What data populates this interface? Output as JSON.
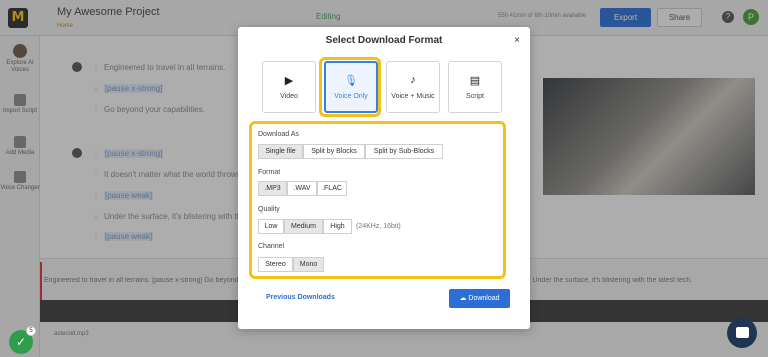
{
  "app": {
    "project_title": "My Awesome Project",
    "crumb": "Home",
    "mode": "Editing",
    "usage": "55h 41min of 6th 10min available",
    "export_label": "Export",
    "share_label": "Share",
    "help_glyph": "?",
    "avatar_initial": "P",
    "logo_glyph": "M"
  },
  "sidebar": {
    "items": [
      {
        "label": "Explore AI Voices",
        "icon": "voice-avatar-icon"
      },
      {
        "label": "Import Script",
        "icon": "import-icon"
      },
      {
        "label": "Add Media",
        "icon": "media-icon"
      },
      {
        "label": "Voice Changer",
        "icon": "voice-changer-icon"
      }
    ]
  },
  "editor": {
    "lines": [
      "Engineered to travel in all terrains.",
      "[pause x-strong]",
      "Go beyond your capabilities.",
      "[pause x-strong]",
      "It doesn't matter what the world throws a",
      "[pause weak]",
      "Under the surface, it's blistering with the",
      "[pause weak]"
    ]
  },
  "timeline": {
    "transcript": "Engineered to travel in all terrains. [pause x-strong] Go beyond your capabilities. [pause x-strong] It doesn't matter what the world throws at you [pause weak] Under the surface, it's blistering with the latest tech.",
    "file": "asteroid.mp3"
  },
  "modal": {
    "title": "Select Download Format",
    "close_glyph": "×",
    "formats": [
      {
        "label": "Video",
        "glyph": "▶",
        "icon": "video-icon",
        "selected": false
      },
      {
        "label": "Voice Only",
        "glyph": "🎙",
        "icon": "microphone-icon",
        "selected": true
      },
      {
        "label": "Voice + Music",
        "glyph": "♪",
        "icon": "voice-music-icon",
        "selected": false
      },
      {
        "label": "Script",
        "glyph": "▤",
        "icon": "script-icon",
        "selected": false
      }
    ],
    "download_as": {
      "label": "Download As",
      "options": [
        "Single file",
        "Split by Blocks",
        "Split by Sub-Blocks"
      ],
      "selected": "Single file"
    },
    "format": {
      "label": "Format",
      "options": [
        ".MP3",
        ".WAV",
        ".FLAC"
      ],
      "selected": ".MP3"
    },
    "quality": {
      "label": "Quality",
      "options": [
        "Low",
        "Medium",
        "High"
      ],
      "selected": "Medium",
      "note": "(24KHz, 16bit)"
    },
    "channel": {
      "label": "Channel",
      "options": [
        "Stereo",
        "Mono"
      ],
      "selected": "Mono"
    },
    "previous_downloads_label": "Previous Downloads",
    "download_label": "Download"
  },
  "widgets": {
    "check_glyph": "✓",
    "check_count": "5"
  },
  "colors": {
    "accent": "#2b6fd6",
    "highlight": "#f2c21b",
    "selected_card": "#3d7fe0",
    "success": "#2e9e4d"
  }
}
